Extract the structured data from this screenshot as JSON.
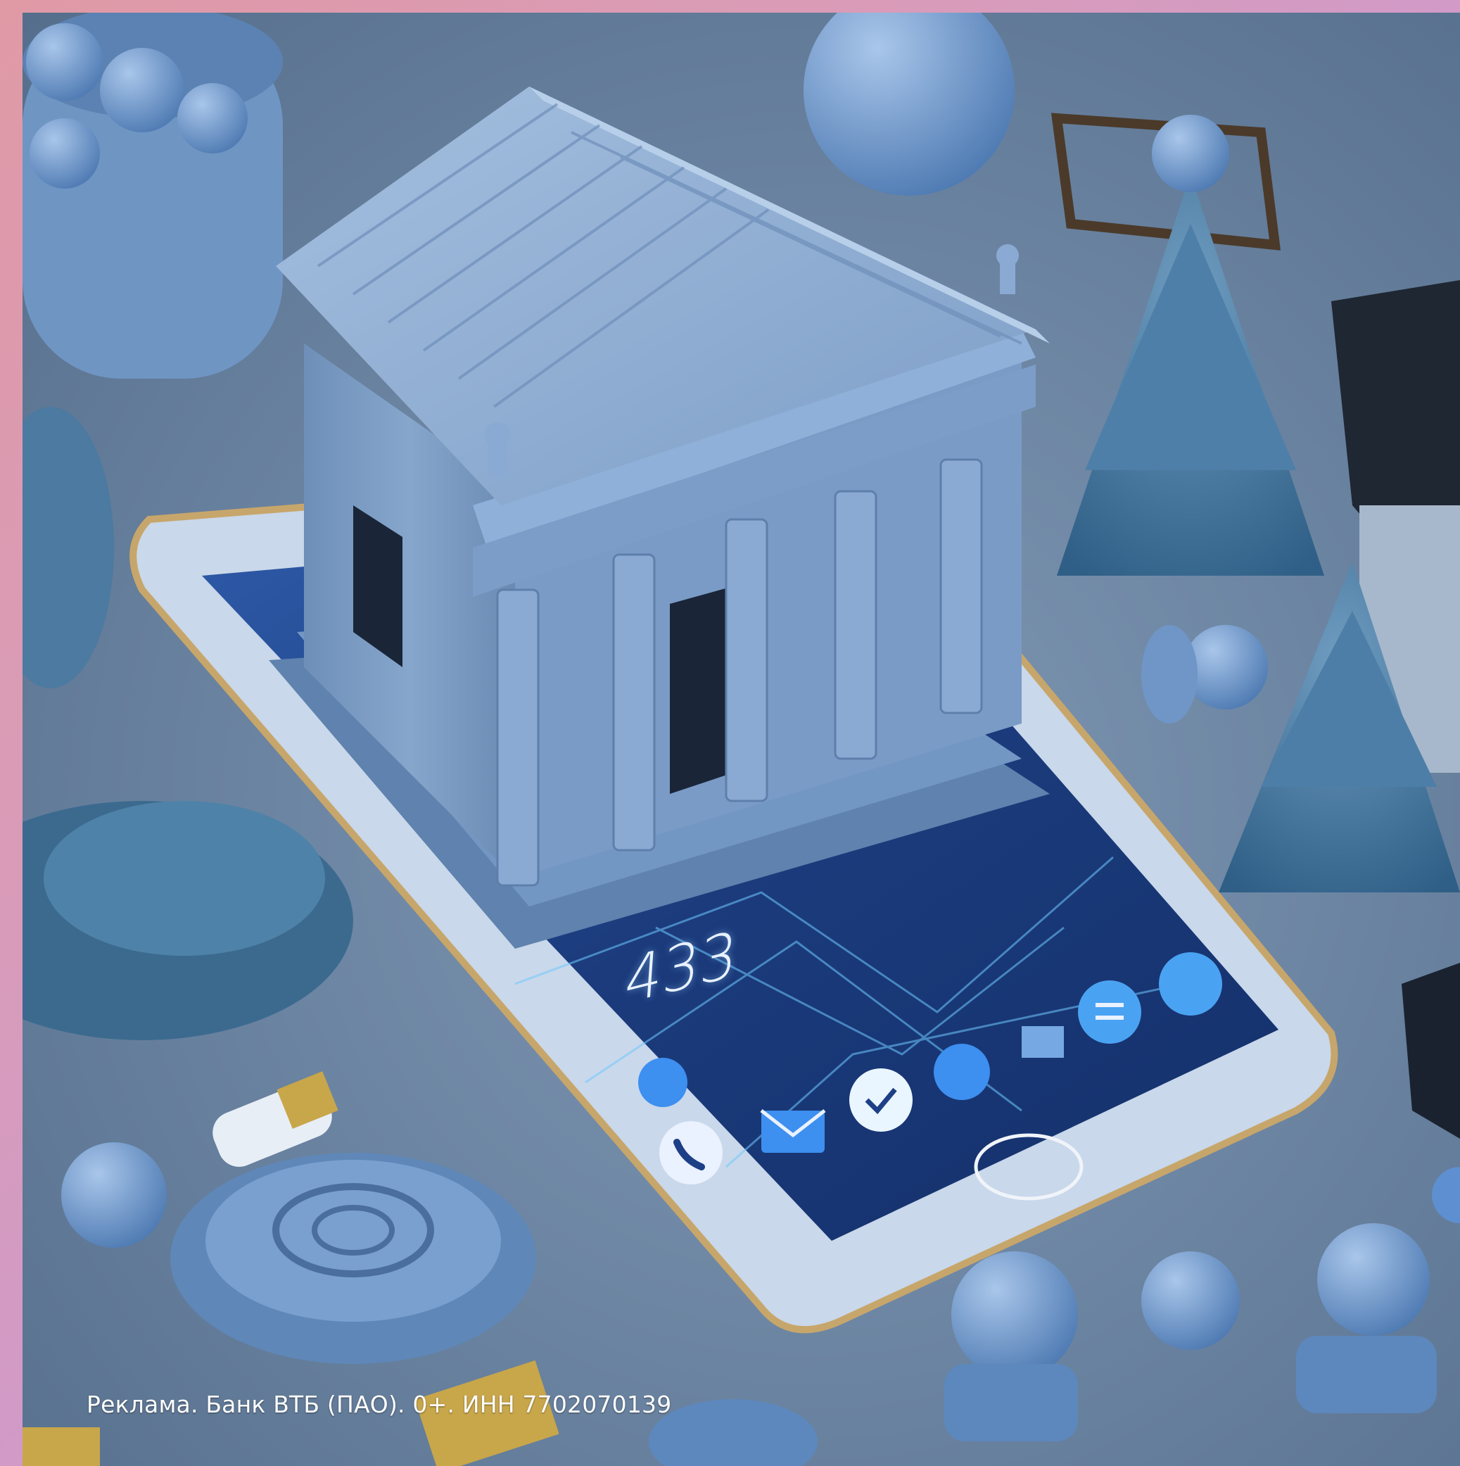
{
  "disclaimer": "Реклама. Банк ВТБ (ПАО). 0+. ИНН 7702070139",
  "phone_screen": {
    "clock_text": "433"
  },
  "colors": {
    "frame_gradient_start": "#e09aa6",
    "frame_gradient_end": "#b79be0",
    "scene_blue": "#7a9cc6",
    "screen_blue": "#1d3f86",
    "accent_icon_blue": "#3d8ff0"
  },
  "icons": [
    "bank-building-icon",
    "phone-call-icon",
    "mail-icon",
    "chat-check-icon",
    "menu-icon",
    "home-button-icon"
  ]
}
